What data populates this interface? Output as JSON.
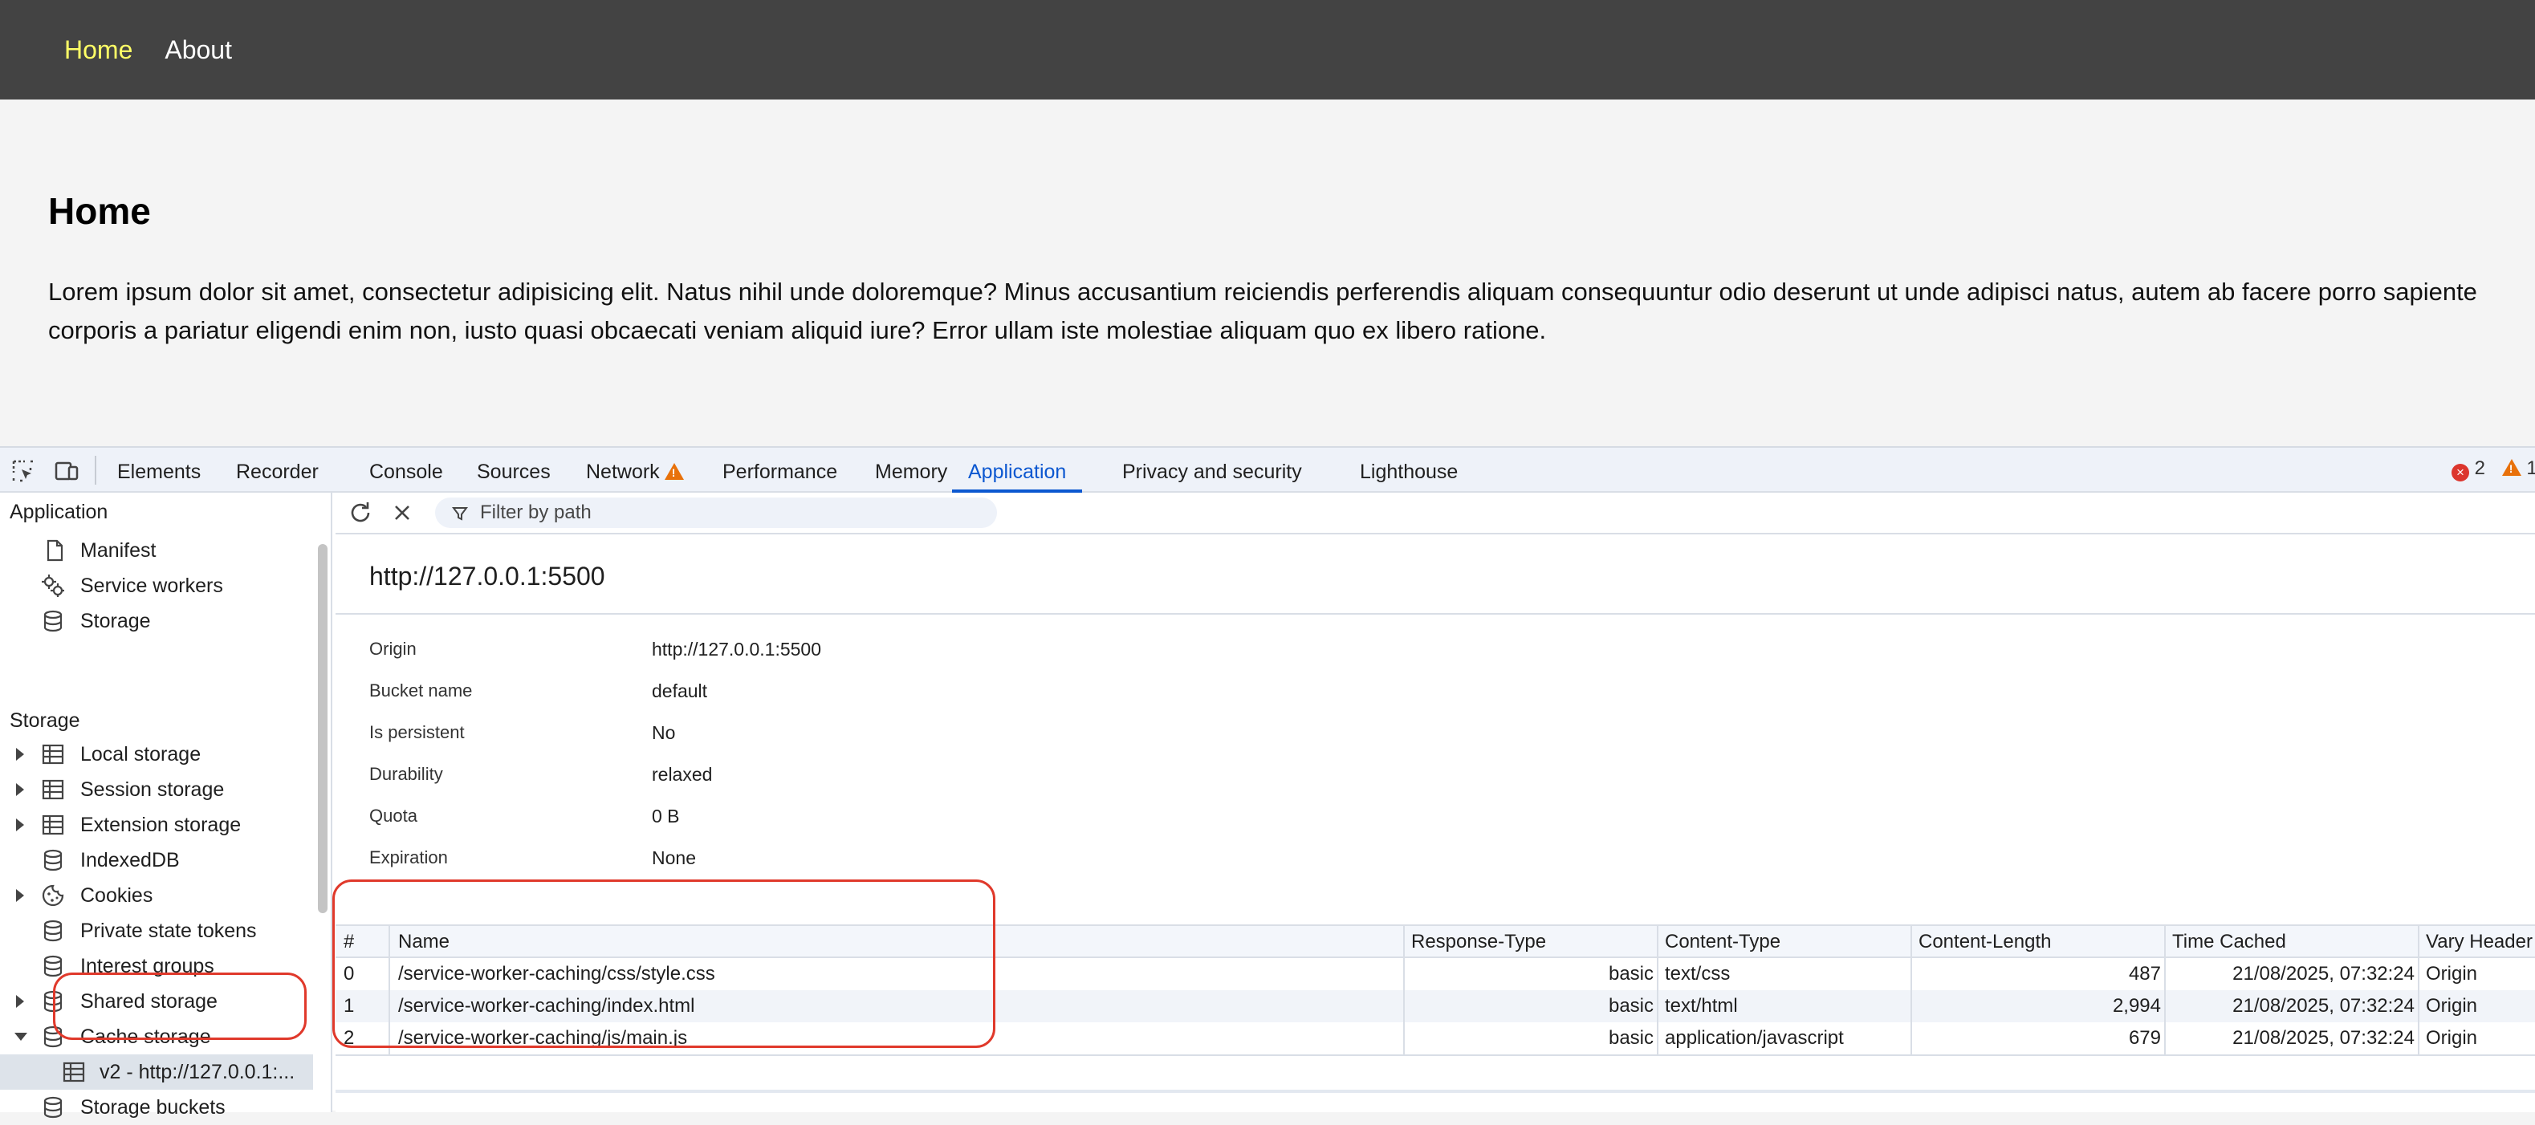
{
  "site": {
    "nav": [
      {
        "label": "Home",
        "active": true
      },
      {
        "label": "About",
        "active": false
      }
    ],
    "heading": "Home",
    "paragraph_line1": "Lorem ipsum dolor sit amet, consectetur adipisicing elit. Natus nihil unde doloremque? Minus accusantium reiciendis perferendis aliquam consequuntur odio deserunt ut unde adipisci natus, autem ab facere porro sapiente",
    "paragraph_line2": "corporis a pariatur eligendi enim non, iusto quasi obcaecati veniam aliquid iure? Error ullam iste molestiae aliquam quo ex libero ratione."
  },
  "devtools": {
    "tabs": [
      "Elements",
      "Recorder",
      "Console",
      "Sources",
      "Network",
      "Performance",
      "Memory",
      "Application",
      "Privacy and security",
      "Lighthouse"
    ],
    "active_tab": "Application",
    "network_warning_icon": "warning-triangle-icon",
    "error_count": "2",
    "warning_count": "1",
    "sidebar": {
      "application_header": "Application",
      "application_items": [
        "Manifest",
        "Service workers",
        "Storage"
      ],
      "storage_header": "Storage",
      "storage_items": [
        "Local storage",
        "Session storage",
        "Extension storage",
        "IndexedDB",
        "Cookies",
        "Private state tokens",
        "Interest groups",
        "Shared storage",
        "Cache storage"
      ],
      "cache_child": "v2 - http://127.0.0.1:...",
      "storage_buckets": "Storage buckets"
    },
    "toolbar": {
      "filter_placeholder": "Filter by path"
    },
    "origin_title": "http://127.0.0.1:5500",
    "details": [
      {
        "key": "Origin",
        "value": "http://127.0.0.1:5500"
      },
      {
        "key": "Bucket name",
        "value": "default"
      },
      {
        "key": "Is persistent",
        "value": "No"
      },
      {
        "key": "Durability",
        "value": "relaxed"
      },
      {
        "key": "Quota",
        "value": "0 B"
      },
      {
        "key": "Expiration",
        "value": "None"
      }
    ],
    "table": {
      "headers": [
        "#",
        "Name",
        "Response-Type",
        "Content-Type",
        "Content-Length",
        "Time Cached",
        "Vary Header"
      ],
      "rows": [
        [
          "0",
          "/service-worker-caching/css/style.css",
          "basic",
          "text/css",
          "487",
          "21/08/2025, 07:32:24",
          "Origin"
        ],
        [
          "1",
          "/service-worker-caching/index.html",
          "basic",
          "text/html",
          "2,994",
          "21/08/2025, 07:32:24",
          "Origin"
        ],
        [
          "2",
          "/service-worker-caching/js/main.js",
          "basic",
          "application/javascript",
          "679",
          "21/08/2025, 07:32:24",
          "Origin"
        ]
      ]
    },
    "colors": {
      "accent": "#0b57d0",
      "highlight": "#e0392b",
      "nav_active": "#ffff66"
    }
  }
}
